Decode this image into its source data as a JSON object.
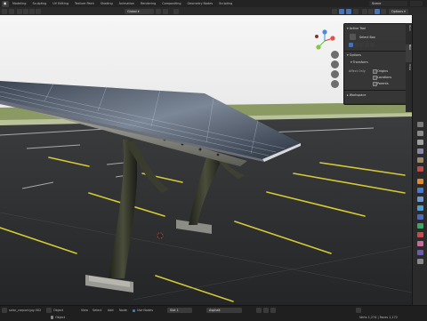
{
  "topbar": {
    "workspace_tabs": [
      "Modeling",
      "Sculpting",
      "UV Editing",
      "Texture Paint",
      "Shading",
      "Animation",
      "Rendering",
      "Compositing",
      "Geometry Nodes",
      "Scripting"
    ],
    "scene_label": "Scene"
  },
  "header": {
    "orientation_label": "Global",
    "options_label": "Options"
  },
  "active_tool_panel": {
    "title": "Active Tool",
    "tool_name": "Select Box",
    "options_title": "Options",
    "transform_title": "Transform",
    "affect_only_label": "Affect Only",
    "origins_label": "Origins",
    "locations_label": "Locations",
    "parents_label": "Parents",
    "workspace_title": "Workspace"
  },
  "sidebar_tabs": [
    "Item",
    "Tool",
    "View"
  ],
  "statusbar": {
    "file_label": "solar_carport.jpg 002",
    "object_label": "Object",
    "menu_view": "View",
    "menu_select": "Select",
    "menu_add": "Add",
    "menu_node": "Node",
    "use_nodes_label": "Use Nodes",
    "slot_label": "Slot 1",
    "material_label": "Asphalt",
    "object_hint": "Object",
    "stats": "Verts 1,274 | Faces 1,172"
  },
  "colors": {
    "accent": "#4772b3",
    "sky": "#f3f3f3",
    "grass": "#8a9a62",
    "asphalt": "#2f3133",
    "parking_line": "#e0d23a"
  }
}
